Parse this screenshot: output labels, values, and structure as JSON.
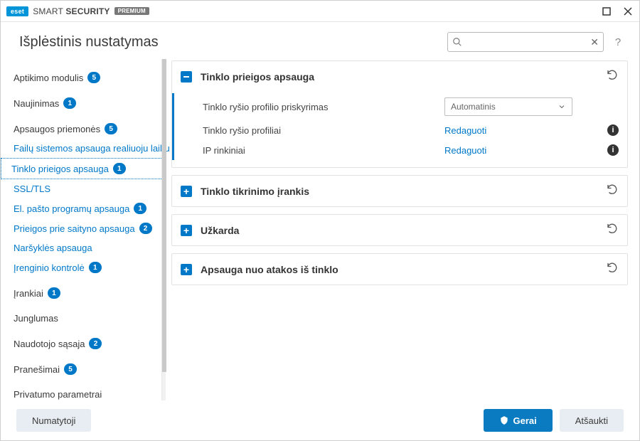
{
  "titlebar": {
    "brand_badge": "eset",
    "brand_name_light": "SMART",
    "brand_name_bold": "SECURITY",
    "tier": "PREMIUM"
  },
  "header": {
    "page_title": "Išplėstinis nustatymas",
    "search_placeholder": "",
    "help_char": "?"
  },
  "sidebar": {
    "items": [
      {
        "label": "Aptikimo modulis",
        "badge": "5",
        "type": "top"
      },
      {
        "label": "Naujinimas",
        "badge": "1",
        "type": "top"
      },
      {
        "label": "Apsaugos priemonės",
        "badge": "5",
        "type": "top"
      },
      {
        "label": "Failų sistemos apsauga realiuoju laiku",
        "badge": null,
        "type": "sub"
      },
      {
        "label": "Tinklo prieigos apsauga",
        "badge": "1",
        "type": "sub",
        "selected": true
      },
      {
        "label": "SSL/TLS",
        "badge": null,
        "type": "sub"
      },
      {
        "label": "El. pašto programų apsauga",
        "badge": "1",
        "type": "sub"
      },
      {
        "label": "Prieigos prie saityno apsauga",
        "badge": "2",
        "type": "sub"
      },
      {
        "label": "Naršyklės apsauga",
        "badge": null,
        "type": "sub"
      },
      {
        "label": "Įrenginio kontrolė",
        "badge": "1",
        "type": "sub"
      },
      {
        "label": "Įrankiai",
        "badge": "1",
        "type": "top"
      },
      {
        "label": "Junglumas",
        "badge": null,
        "type": "top"
      },
      {
        "label": "Naudotojo sąsaja",
        "badge": "2",
        "type": "top"
      },
      {
        "label": "Pranešimai",
        "badge": "5",
        "type": "top"
      },
      {
        "label": "Privatumo parametrai",
        "badge": null,
        "type": "top"
      }
    ]
  },
  "main": {
    "panels": [
      {
        "expanded": true,
        "title": "Tinklo prieigos apsauga",
        "rows": [
          {
            "label": "Tinklo ryšio profilio priskyrimas",
            "control": "select",
            "value": "Automatinis"
          },
          {
            "label": "Tinklo ryšio profiliai",
            "control": "link",
            "value": "Redaguoti",
            "info": true
          },
          {
            "label": "IP rinkiniai",
            "control": "link",
            "value": "Redaguoti",
            "info": true
          }
        ]
      },
      {
        "expanded": false,
        "title": "Tinklo tikrinimo įrankis"
      },
      {
        "expanded": false,
        "title": "Užkarda"
      },
      {
        "expanded": false,
        "title": "Apsauga nuo atakos iš tinklo"
      }
    ]
  },
  "footer": {
    "default_btn": "Numatytoji",
    "ok_btn": "Gerai",
    "cancel_btn": "Atšaukti"
  }
}
